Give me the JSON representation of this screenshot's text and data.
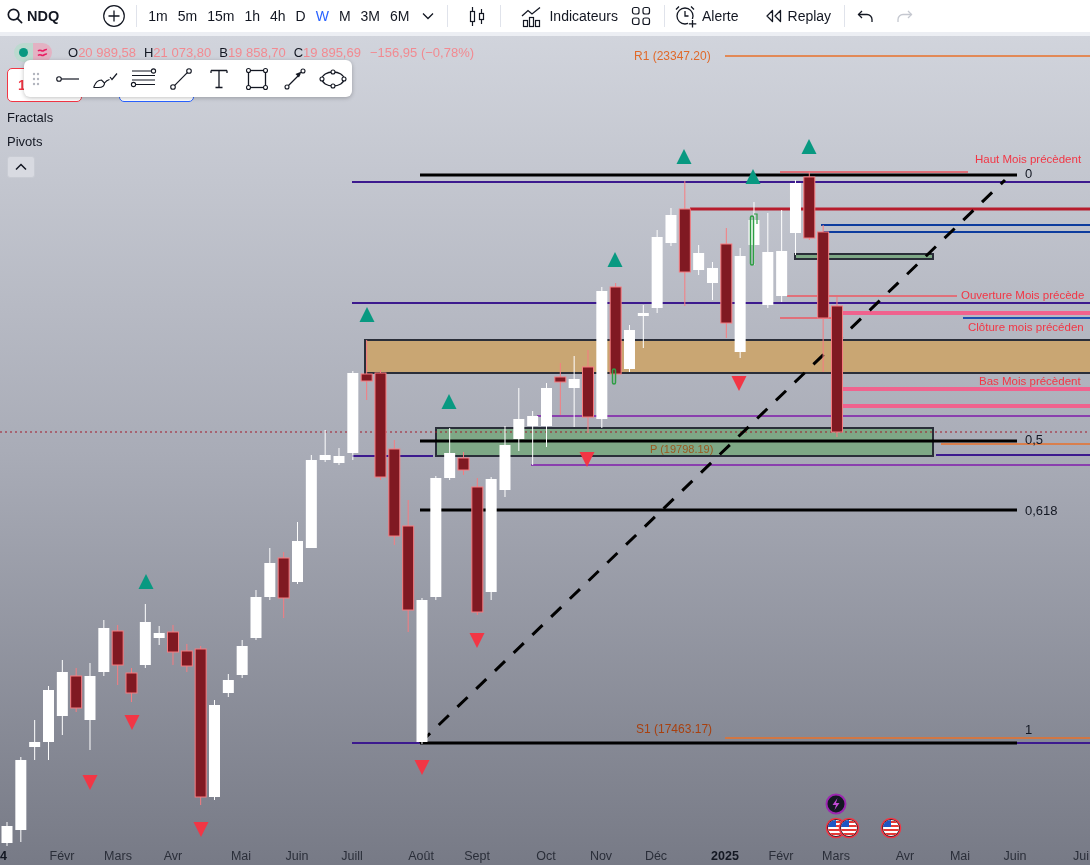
{
  "toolbar": {
    "symbol": "NDQ",
    "intervals": [
      {
        "label": "1m",
        "selected": false
      },
      {
        "label": "5m",
        "selected": false
      },
      {
        "label": "15m",
        "selected": false
      },
      {
        "label": "1h",
        "selected": false
      },
      {
        "label": "4h",
        "selected": false
      },
      {
        "label": "D",
        "selected": false
      },
      {
        "label": "W",
        "selected": true
      },
      {
        "label": "M",
        "selected": false
      },
      {
        "label": "3M",
        "selected": false
      },
      {
        "label": "6M",
        "selected": false
      }
    ],
    "indicators": "Indicateurs",
    "alert": "Alerte",
    "replay": "Replay",
    "undo": {
      "disabled": false
    },
    "redo": {
      "disabled": true
    }
  },
  "legend": {
    "values": [
      {
        "label": "O",
        "value": "20 989,58"
      },
      {
        "label": "H",
        "value": "21 073,80"
      },
      {
        "label": "B",
        "value": "19 858,70"
      },
      {
        "label": "C",
        "value": "19 895,69"
      }
    ],
    "change": "−156,95 (−0,78%)"
  },
  "series_buttons": [
    {
      "text": "1",
      "color": "#f23645"
    },
    {
      "color": "#2962ff"
    }
  ],
  "indicators": [
    {
      "name": "Fractals"
    },
    {
      "name": "Pivots"
    }
  ],
  "collapse_button": {
    "expanded": true
  },
  "chart": {
    "pivots": [
      {
        "label": "R1 (23347.20)"
      },
      {
        "label": "P (19798.19)"
      },
      {
        "label": "S1 (17463.17)"
      }
    ],
    "monthly_levels": [
      {
        "label": "Haut Mois précèdent"
      },
      {
        "label": "Ouverture Mois précède"
      },
      {
        "label": "Clôture mois précéden"
      },
      {
        "label": "Bas Mois précèdent"
      }
    ],
    "fib_levels": [
      "0",
      "0,5",
      "0,618",
      "1"
    ]
  },
  "time_axis": [
    {
      "label": "4",
      "kind": "year"
    },
    {
      "label": "Févr",
      "kind": "month"
    },
    {
      "label": "Mars",
      "kind": "month"
    },
    {
      "label": "Avr",
      "kind": "month"
    },
    {
      "label": "Mai",
      "kind": "month"
    },
    {
      "label": "Juin",
      "kind": "month"
    },
    {
      "label": "Juill",
      "kind": "month"
    },
    {
      "label": "Août",
      "kind": "month"
    },
    {
      "label": "Sept",
      "kind": "month"
    },
    {
      "label": "Oct",
      "kind": "month"
    },
    {
      "label": "Nov",
      "kind": "month"
    },
    {
      "label": "Déc",
      "kind": "month"
    },
    {
      "label": "2025",
      "kind": "year"
    },
    {
      "label": "Févr",
      "kind": "month"
    },
    {
      "label": "Mars",
      "kind": "month"
    },
    {
      "label": "Avr",
      "kind": "month"
    },
    {
      "label": "Mai",
      "kind": "month"
    },
    {
      "label": "Juin",
      "kind": "month"
    },
    {
      "label": "Jui",
      "kind": "month"
    }
  ]
}
